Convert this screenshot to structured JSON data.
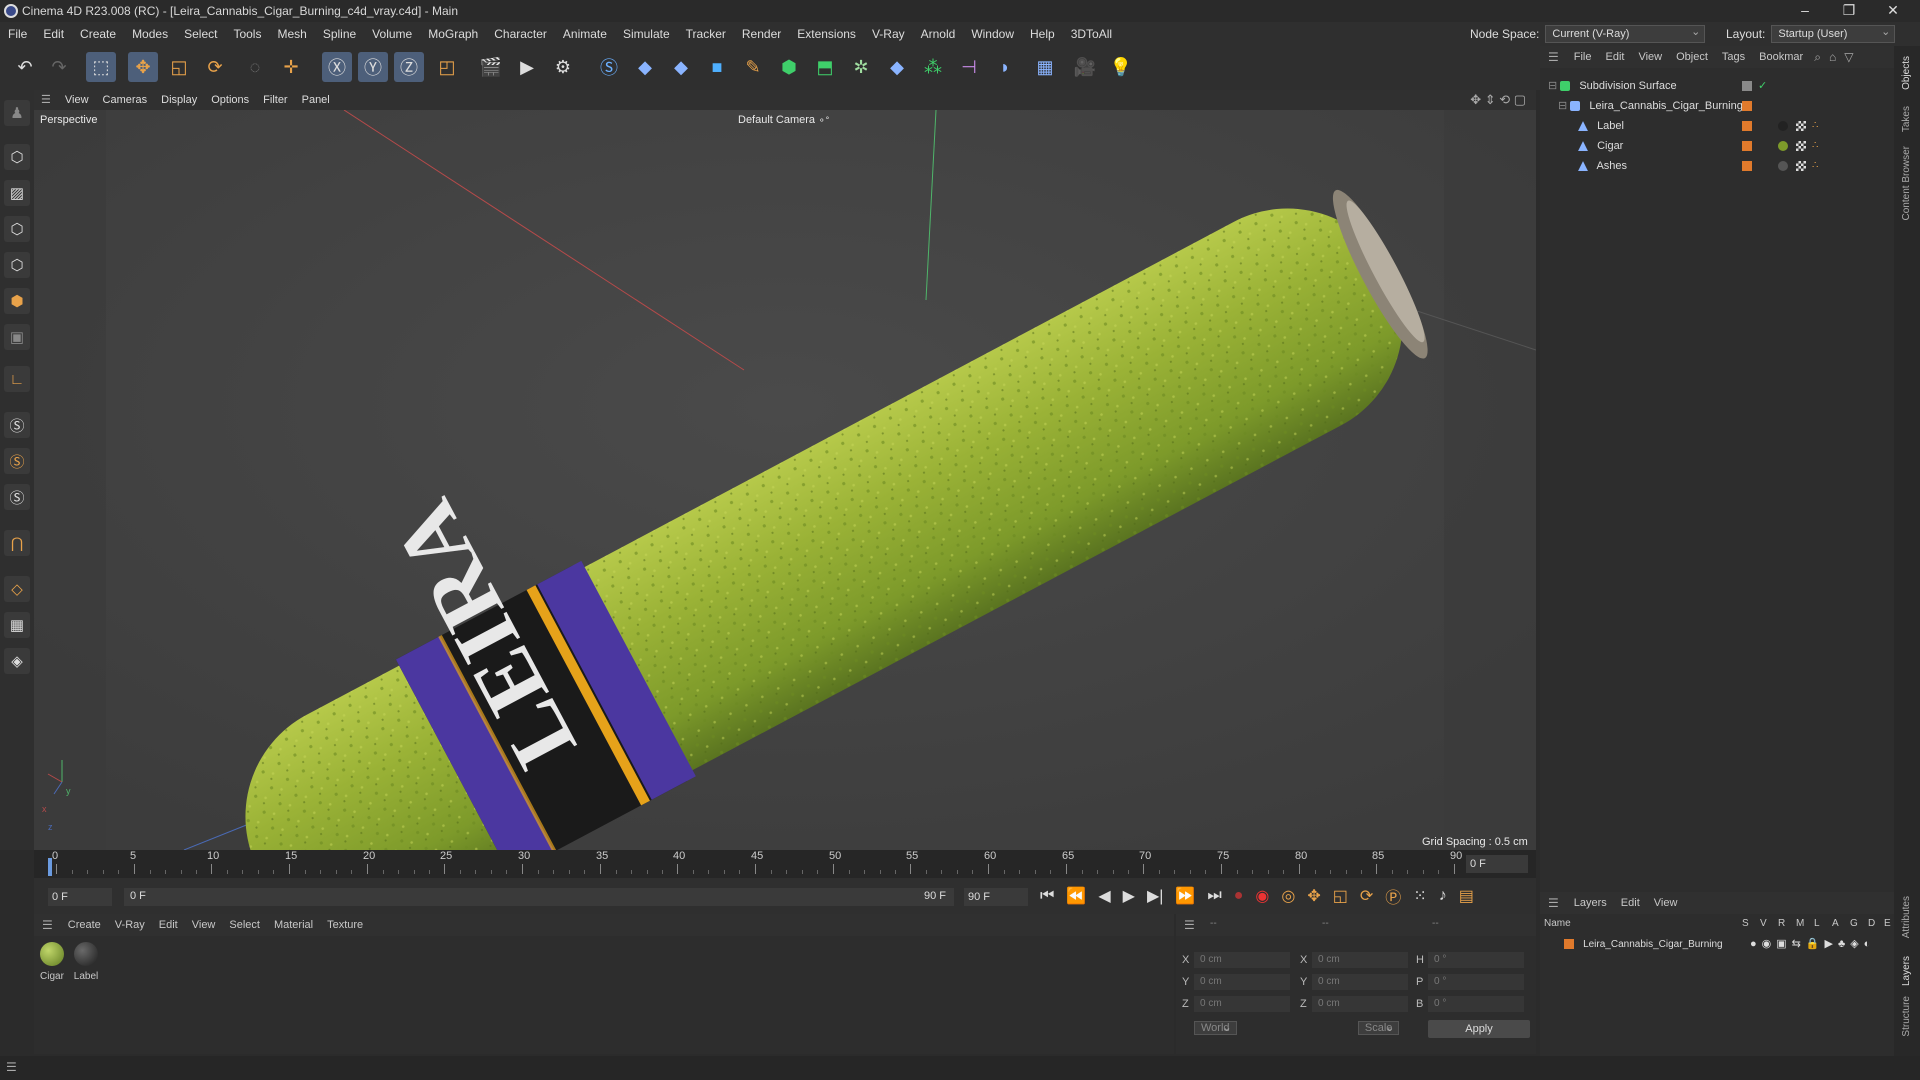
{
  "window": {
    "title": "Cinema 4D R23.008 (RC) - [Leira_Cannabis_Cigar_Burning_c4d_vray.c4d] - Main"
  },
  "menu": [
    "File",
    "Edit",
    "Create",
    "Modes",
    "Select",
    "Tools",
    "Mesh",
    "Spline",
    "Volume",
    "MoGraph",
    "Character",
    "Animate",
    "Simulate",
    "Tracker",
    "Render",
    "Extensions",
    "V-Ray",
    "Arnold",
    "Window",
    "Help",
    "3DToAll"
  ],
  "node_space": {
    "label": "Node Space:",
    "value": "Current (V-Ray)"
  },
  "layout": {
    "label": "Layout:",
    "value": "Startup (User)"
  },
  "viewport": {
    "menu": [
      "View",
      "Cameras",
      "Display",
      "Options",
      "Filter",
      "Panel"
    ],
    "view_name": "Perspective",
    "camera": "Default Camera",
    "camera_suffix": "⚬°",
    "grid_spacing": "Grid Spacing : 0.5 cm",
    "axis_y": "y",
    "axis_x": "x",
    "axis_z": "z"
  },
  "timeline": {
    "ticks": [
      "0",
      "5",
      "10",
      "15",
      "20",
      "25",
      "30",
      "35",
      "40",
      "45",
      "50",
      "55",
      "60",
      "65",
      "70",
      "75",
      "80",
      "85",
      "90"
    ],
    "frame_field": "0 F"
  },
  "transport": {
    "start": "0 F",
    "current": "0 F",
    "end_a": "90 F",
    "end_b": "90 F"
  },
  "materials": {
    "menu": [
      "Create",
      "V-Ray",
      "Edit",
      "View",
      "Select",
      "Material",
      "Texture"
    ],
    "items": [
      {
        "label": "Cigar"
      },
      {
        "label": "Label"
      }
    ]
  },
  "coords": {
    "headers": [
      "--",
      "--",
      "--"
    ],
    "rows": [
      {
        "a": "X",
        "av": "0 cm",
        "b": "X",
        "bv": "0 cm",
        "c": "H",
        "cv": "0 °"
      },
      {
        "a": "Y",
        "av": "0 cm",
        "b": "Y",
        "bv": "0 cm",
        "c": "P",
        "cv": "0 °"
      },
      {
        "a": "Z",
        "av": "0 cm",
        "b": "Z",
        "bv": "0 cm",
        "c": "B",
        "cv": "0 °"
      }
    ],
    "mode": "World",
    "scale": "Scale",
    "apply": "Apply"
  },
  "objects": {
    "menu": [
      "File",
      "Edit",
      "View",
      "Object",
      "Tags",
      "Bookmar"
    ],
    "items": [
      {
        "label": "Subdivision Surface"
      },
      {
        "label": "Leira_Cannabis_Cigar_Burning"
      },
      {
        "label": "Label"
      },
      {
        "label": "Cigar"
      },
      {
        "label": "Ashes"
      }
    ]
  },
  "layers": {
    "menu": [
      "Layers",
      "Edit",
      "View"
    ],
    "name_header": "Name",
    "flags": [
      "S",
      "V",
      "R",
      "M",
      "L",
      "A",
      "G",
      "D",
      "E"
    ],
    "items": [
      {
        "label": "Leira_Cannabis_Cigar_Burning"
      }
    ]
  },
  "right_tabs": [
    "Objects",
    "Takes",
    "Content Browser",
    "Attributes",
    "Layers",
    "Structure"
  ],
  "colors": {
    "accent": "#4d5f7a",
    "orange": "#e07a2c",
    "cigar_green": "#8fae2e"
  }
}
